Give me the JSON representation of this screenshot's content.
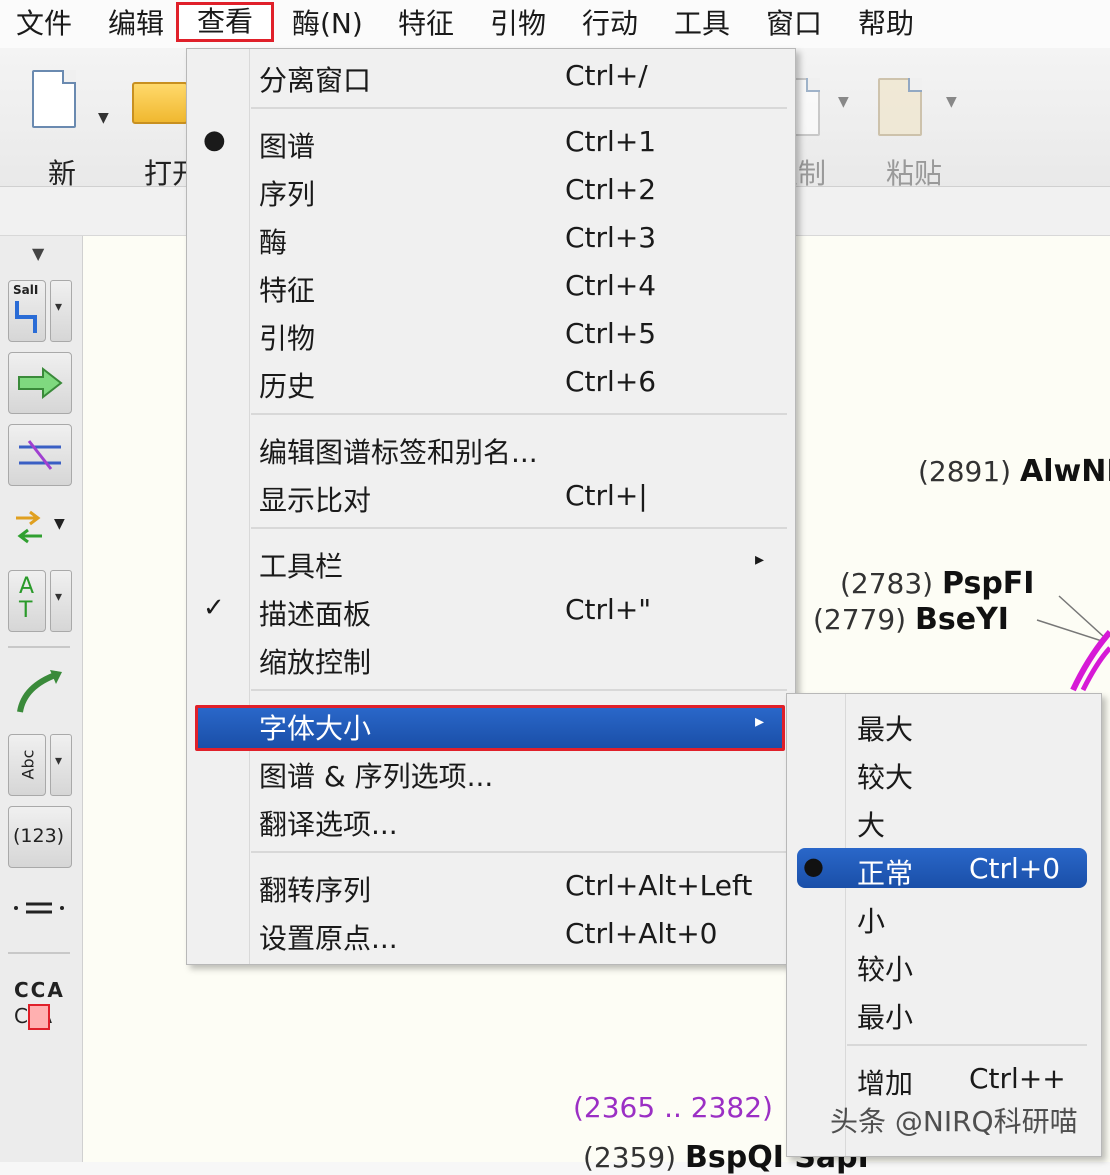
{
  "menubar": {
    "items": [
      "文件",
      "编辑",
      "查看",
      "酶(N)",
      "特征",
      "引物",
      "行动",
      "工具",
      "窗口",
      "帮助"
    ],
    "active_index": 2
  },
  "toolbar": {
    "new_label": "新",
    "open_label": "打开",
    "copy_label": "复制",
    "paste_label": "粘贴"
  },
  "palette": {
    "enzyme_tool_text": "SalI",
    "primer_tool_text": "AT",
    "abc_tool_text": "Abc",
    "number_tool_text": "(123)",
    "seq_top": "CCA",
    "seq_bottom": "C A"
  },
  "map": {
    "site1": {
      "pos": "(2891)",
      "name": "AlwNI"
    },
    "site2": {
      "pos": "(2783)",
      "name": "PspFI"
    },
    "site3": {
      "pos": "(2779)",
      "name": "BseYI"
    },
    "range": "(2365 .. 2382)",
    "site4": {
      "pos": "(2359)",
      "name": "BspQI  SapI"
    },
    "accent_color": "#d61ad6"
  },
  "view_menu": {
    "items": [
      {
        "label": "分离窗口",
        "shortcut": "Ctrl+/",
        "mark": ""
      },
      {
        "label": "图谱",
        "shortcut": "Ctrl+1",
        "mark": "●"
      },
      {
        "label": "序列",
        "shortcut": "Ctrl+2",
        "mark": ""
      },
      {
        "label": "酶",
        "shortcut": "Ctrl+3",
        "mark": ""
      },
      {
        "label": "特征",
        "shortcut": "Ctrl+4",
        "mark": ""
      },
      {
        "label": "引物",
        "shortcut": "Ctrl+5",
        "mark": ""
      },
      {
        "label": "历史",
        "shortcut": "Ctrl+6",
        "mark": ""
      },
      {
        "label": "编辑图谱标签和别名...",
        "shortcut": "",
        "mark": ""
      },
      {
        "label": "显示比对",
        "shortcut": "Ctrl+|",
        "mark": ""
      },
      {
        "label": "工具栏",
        "shortcut": "",
        "mark": "",
        "submenu": "▸"
      },
      {
        "label": "描述面板",
        "shortcut": "Ctrl+\"",
        "mark": "✓"
      },
      {
        "label": "缩放控制",
        "shortcut": "",
        "mark": ""
      },
      {
        "label": "字体大小",
        "shortcut": "",
        "mark": "",
        "submenu": "▸",
        "highlighted": true
      },
      {
        "label": "图谱 & 序列选项...",
        "shortcut": "",
        "mark": ""
      },
      {
        "label": "翻译选项...",
        "shortcut": "",
        "mark": ""
      },
      {
        "label": "翻转序列",
        "shortcut": "Ctrl+Alt+Left",
        "mark": ""
      },
      {
        "label": "设置原点...",
        "shortcut": "Ctrl+Alt+0",
        "mark": ""
      }
    ]
  },
  "font_submenu": {
    "items": [
      {
        "label": "最大",
        "shortcut": "",
        "mark": ""
      },
      {
        "label": "较大",
        "shortcut": "",
        "mark": ""
      },
      {
        "label": "大",
        "shortcut": "",
        "mark": ""
      },
      {
        "label": "正常",
        "shortcut": "Ctrl+0",
        "mark": "●",
        "selected": true
      },
      {
        "label": "小",
        "shortcut": "",
        "mark": ""
      },
      {
        "label": "较小",
        "shortcut": "",
        "mark": ""
      },
      {
        "label": "最小",
        "shortcut": "",
        "mark": ""
      },
      {
        "label": "增加",
        "shortcut": "Ctrl++",
        "mark": ""
      }
    ]
  },
  "watermark": "头条 @NIRQ科研喵",
  "colors": {
    "highlight": "#1a4fa8",
    "annotation_red": "#e0202a"
  }
}
